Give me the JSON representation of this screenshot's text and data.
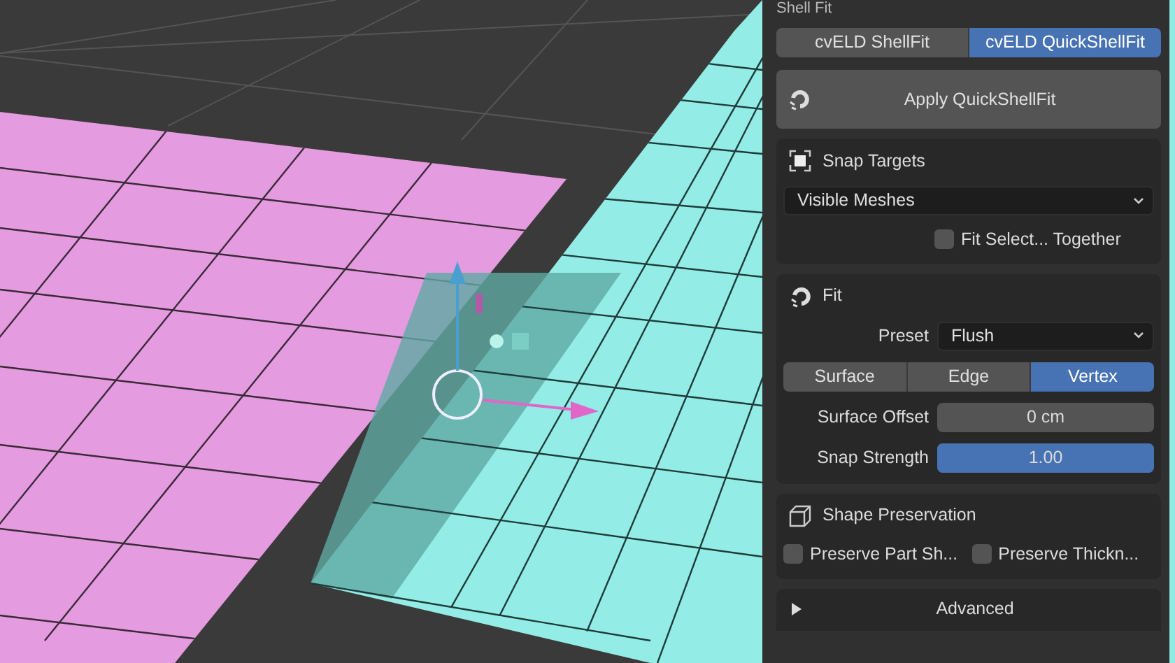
{
  "panel": {
    "title": "Shell Fit"
  },
  "tabs": [
    {
      "label": "cvELD ShellFit",
      "selected": false
    },
    {
      "label": "cvELD QuickShellFit",
      "selected": true
    }
  ],
  "apply_button": {
    "label": "Apply QuickShellFit"
  },
  "snap_targets": {
    "title": "Snap Targets",
    "dropdown": {
      "value": "Visible Meshes"
    },
    "checkbox": {
      "label": "Fit Select... Together",
      "checked": false
    }
  },
  "fit": {
    "title": "Fit",
    "preset": {
      "label": "Preset",
      "value": "Flush"
    },
    "modes": [
      {
        "label": "Surface",
        "selected": false
      },
      {
        "label": "Edge",
        "selected": false
      },
      {
        "label": "Vertex",
        "selected": true
      }
    ],
    "fields": [
      {
        "label": "Surface Offset",
        "value": "0 cm",
        "kind": "number"
      },
      {
        "label": "Snap Strength",
        "value": "1.00",
        "kind": "slider",
        "level": 1
      }
    ]
  },
  "shape_preservation": {
    "title": "Shape Preservation",
    "checkboxes": [
      {
        "label": "Preserve Part Sh...",
        "checked": false
      },
      {
        "label": "Preserve Thickn...",
        "checked": false
      }
    ]
  },
  "advanced": {
    "label": "Advanced",
    "expanded": false
  }
}
